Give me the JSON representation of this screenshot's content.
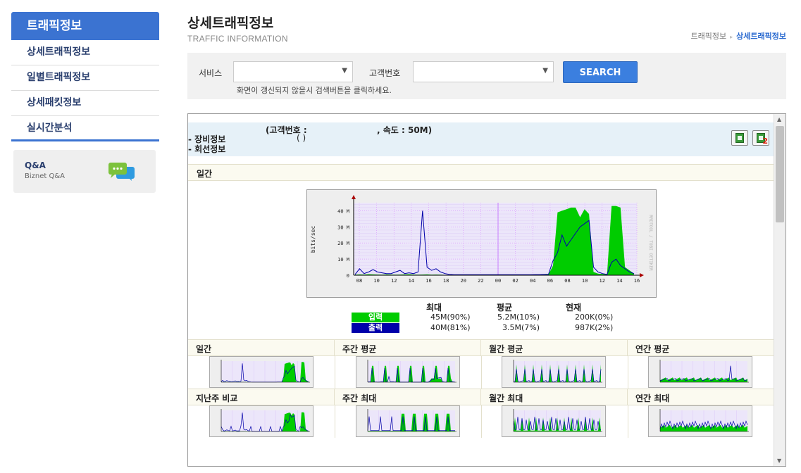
{
  "sidebar": {
    "header": "트래픽정보",
    "items": [
      {
        "label": "상세트래픽정보"
      },
      {
        "label": "일별트래픽정보"
      },
      {
        "label": "상세패킷정보"
      },
      {
        "label": "실시간분석"
      }
    ],
    "qna": {
      "title": "Q&A",
      "subtitle": "Biznet Q&A",
      "icon": "chat-bubbles-icon"
    }
  },
  "header": {
    "title": "상세트래픽정보",
    "subtitle": "TRAFFIC INFORMATION",
    "breadcrumb": [
      "트래픽정보",
      "상세트래픽정보"
    ]
  },
  "search": {
    "service_label": "서비스",
    "service_value": "",
    "customer_label": "고객번호",
    "customer_value": "",
    "button": "SEARCH",
    "hint": "화면이 갱신되지 않을시 검색버튼을 클릭하세요."
  },
  "result": {
    "customer_info": "(고객번호 :",
    "speed_info": ", 속도 : 50M)",
    "equipment": "- 장비정보",
    "equipment_paren": "(          )",
    "line": "- 회선정보",
    "export_icons": [
      "excel-export-icon",
      "excel-export-2-icon"
    ],
    "export2_badge": "2",
    "section_daily": "일간"
  },
  "chart_data": {
    "type": "area",
    "ylabel": "bits/sec",
    "y_ticks": [
      "0",
      "10 M",
      "20 M",
      "30 M",
      "40 M"
    ],
    "x_ticks": [
      "08",
      "10",
      "12",
      "14",
      "16",
      "18",
      "20",
      "22",
      "00",
      "02",
      "04",
      "06",
      "08",
      "10",
      "12",
      "14",
      "16"
    ],
    "watermark": "RRDTOOL / TOBI OETIKER",
    "ylim": [
      0,
      45
    ],
    "colors": {
      "input": "#00cc00",
      "output": "#0000aa",
      "plot_bg": "#ece6fa",
      "grid": "#d98cff"
    },
    "series": [
      {
        "name": "입력",
        "values": [
          0.3,
          0.5,
          0.4,
          0.6,
          0.5,
          0.4,
          0.3,
          0.5,
          0.4,
          0.3,
          0.4,
          0.5,
          0.6,
          0.4,
          0.3,
          0.4,
          0.5,
          0.3,
          0.4,
          0.3,
          0.2,
          0.2,
          0.2,
          0.2,
          0.2,
          0.2,
          0.2,
          0.2,
          0.2,
          0.2,
          0.2,
          0.2,
          0.2,
          0.2,
          0.2,
          0.2,
          0.2,
          0.2,
          0.2,
          0.3,
          0.3,
          0.2,
          0.3,
          0.5,
          6,
          39,
          40,
          41,
          42,
          42,
          36,
          41,
          38,
          2,
          1,
          0.8,
          0.5,
          43,
          43,
          42,
          5,
          3,
          1
        ]
      },
      {
        "name": "출력",
        "values": [
          0.5,
          4,
          1,
          2,
          3.5,
          2,
          1.5,
          1,
          1,
          2,
          3,
          1,
          1.5,
          1,
          2,
          40,
          5,
          3,
          4,
          2,
          1,
          0.5,
          0.3,
          0.3,
          0.3,
          0.3,
          0.3,
          0.3,
          0.3,
          0.3,
          0.3,
          0.3,
          0.3,
          0.3,
          0.3,
          0.3,
          0.3,
          0.3,
          0.3,
          0.3,
          0.4,
          0.4,
          0.5,
          0.6,
          9,
          14,
          25,
          18,
          22,
          26,
          30,
          32,
          34,
          5,
          2,
          1,
          0.5,
          8,
          10,
          6,
          4,
          2,
          1
        ]
      }
    ],
    "legend": {
      "headers": [
        "최대",
        "평균",
        "현재"
      ],
      "rows": [
        {
          "name": "입력",
          "max": "45M(90%)",
          "avg": "5.2M(10%)",
          "cur": "200K(0%)",
          "color": "#00cc00"
        },
        {
          "name": "출력",
          "max": "40M(81%)",
          "avg": "3.5M(7%)",
          "cur": "987K(2%)",
          "color": "#0000aa"
        }
      ]
    }
  },
  "thumbnails": [
    {
      "label": "일간"
    },
    {
      "label": "주간 평균"
    },
    {
      "label": "월간 평균"
    },
    {
      "label": "연간 평균"
    },
    {
      "label": "지난주 비교"
    },
    {
      "label": "주간 최대"
    },
    {
      "label": "월간 최대"
    },
    {
      "label": "연간 최대"
    }
  ]
}
